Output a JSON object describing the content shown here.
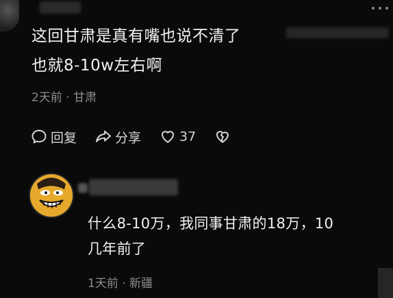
{
  "comment": {
    "line1": "这回甘肃是真有嘴也说不清了",
    "line2": "也就8-10w左右啊",
    "meta": "2天前 · 甘肃",
    "actions": {
      "reply_label": "回复",
      "share_label": "分享",
      "like_count": "37"
    }
  },
  "reply": {
    "line1": "什么8-10万，我同事甘肃的18万，10",
    "line2": "几年前了",
    "meta": "1天前 · 新疆"
  },
  "colors": {
    "background": "#0a0a0a",
    "text": "#f2f2f2",
    "meta": "#8d8d8d",
    "avatar": "#e6a92c"
  }
}
